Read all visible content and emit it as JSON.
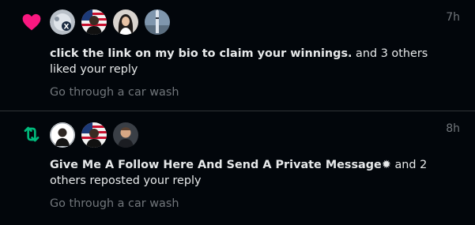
{
  "colors": {
    "background": "#02060b",
    "text_primary": "#e7e9ea",
    "text_secondary": "#71767b",
    "like": "#f91880",
    "repost": "#00ba7c",
    "divider": "#2f3336"
  },
  "notifications": [
    {
      "type": "like",
      "icon": "heart-icon",
      "timestamp": "7h",
      "actor_name": "click the link on my bio to claim your winnings.",
      "action_text": " and 3 others liked your reply",
      "preview": "Go through a car wash",
      "avatars": [
        "avatar-x-logo",
        "avatar-flag-portrait",
        "avatar-woman-portrait",
        "avatar-rocket"
      ]
    },
    {
      "type": "repost",
      "icon": "repost-icon",
      "timestamp": "8h",
      "actor_name": "Give Me A Follow Here And Send A Private Message✹",
      "action_text": " and 2 others reposted your reply",
      "preview": "Go through a car wash",
      "avatars": [
        "avatar-man-portrait",
        "avatar-flag-portrait",
        "avatar-man-portrait-2"
      ]
    }
  ]
}
